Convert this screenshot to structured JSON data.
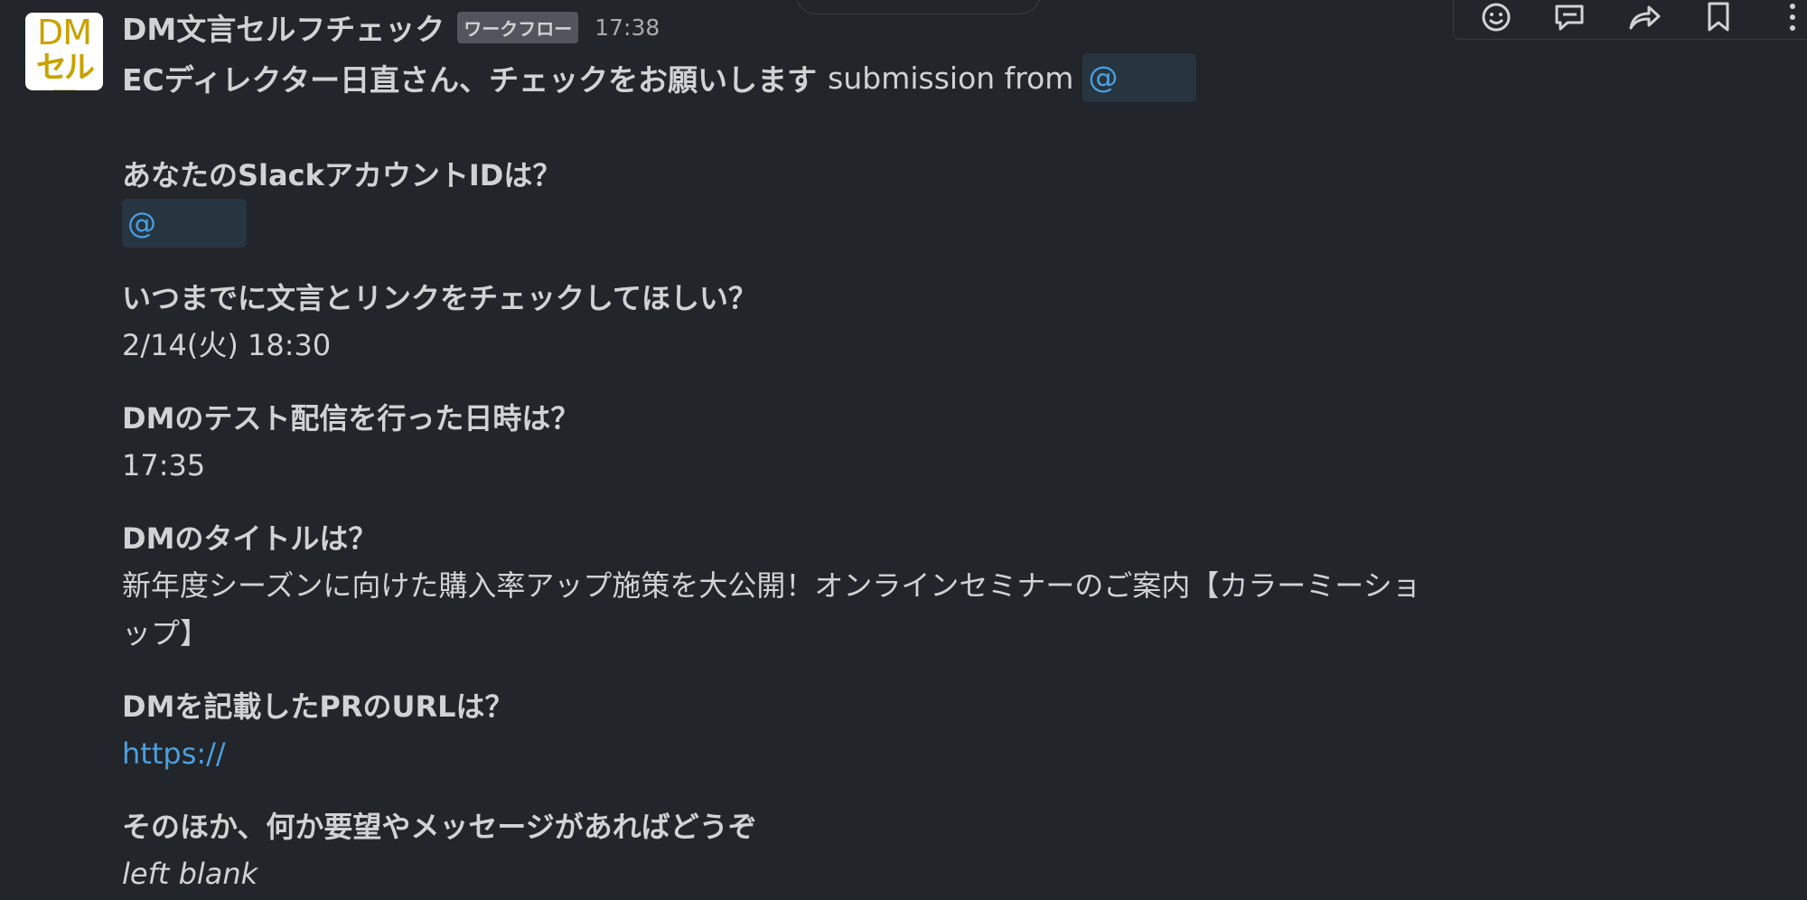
{
  "app": {
    "name": "DM文言セルフチェック",
    "badge": "ワークフロー",
    "time": "17:38",
    "avatar_top": "DM",
    "avatar_bottom": "セルフ"
  },
  "message": {
    "lead_strong": "ECディレクター日直さん、チェックをお願いします",
    "lead_rest": "submission from",
    "lead_mention": "@"
  },
  "fields": [
    {
      "label": "あなたのSlackアカウントIDは？",
      "value": "@"
    },
    {
      "label": "いつまでに文言とリンクをチェックしてほしい？",
      "value": "2/14(火) 18:30"
    },
    {
      "label": "DMのテスト配信を行った日時は？",
      "value": "17:35"
    },
    {
      "label": "DMのタイトルは？",
      "value": "新年度シーズンに向けた購入率アップ施策を大公開！オンラインセミナーのご案内【カラーミーショップ】"
    },
    {
      "label": "DMを記載したPRのURLは？",
      "value": "https://"
    },
    {
      "label": "そのほか、何か要望やメッセージがあればどうぞ",
      "value": "left blank"
    }
  ],
  "toolbar": {
    "icons": [
      "add-reaction-icon",
      "reply-in-thread-icon",
      "share-icon",
      "bookmark-icon",
      "more-actions-icon"
    ]
  },
  "colors": {
    "background": "#222529",
    "text": "#d1d2d3",
    "link": "#4a9fe0",
    "mention_bg": "#273541",
    "avatar_text": "#c8a200"
  }
}
